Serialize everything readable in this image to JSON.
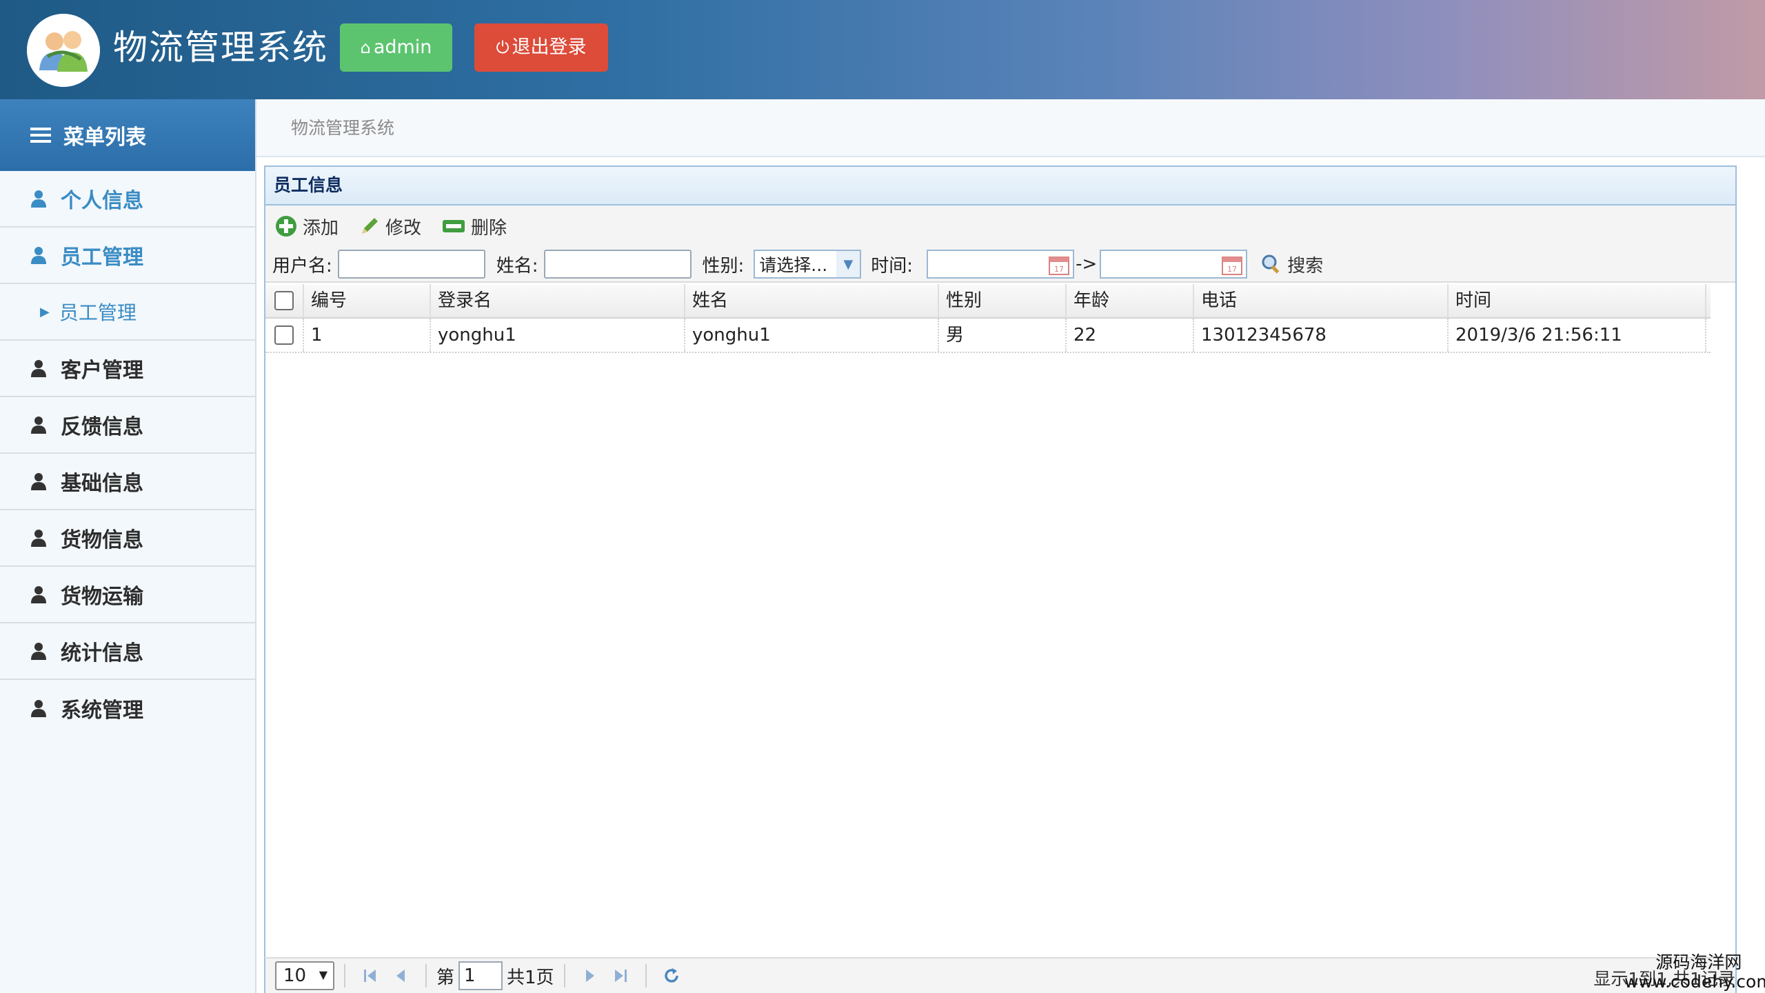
{
  "header": {
    "app_title": "物流管理系统",
    "admin_label": "admin",
    "logout_label": "退出登录"
  },
  "sidebar": {
    "menu_title": "菜单列表",
    "items": [
      {
        "label": "个人信息",
        "active": true
      },
      {
        "label": "员工管理",
        "active": true
      },
      {
        "label": "员工管理",
        "sub": true
      },
      {
        "label": "客户管理"
      },
      {
        "label": "反馈信息"
      },
      {
        "label": "基础信息"
      },
      {
        "label": "货物信息"
      },
      {
        "label": "货物运输"
      },
      {
        "label": "统计信息"
      },
      {
        "label": "系统管理"
      }
    ]
  },
  "breadcrumb": "物流管理系统",
  "panel": {
    "title": "员工信息",
    "toolbar": {
      "add": "添加",
      "edit": "修改",
      "delete": "删除"
    },
    "search": {
      "username_label": "用户名:",
      "name_label": "姓名:",
      "sex_label": "性别:",
      "sex_selected": "请选择...",
      "time_label": "时间:",
      "range_sep": "->",
      "search_label": "搜索"
    },
    "columns": [
      "编号",
      "登录名",
      "姓名",
      "性别",
      "年龄",
      "电话",
      "时间"
    ],
    "rows": [
      [
        "1",
        "yonghu1",
        "yonghu1",
        "男",
        "22",
        "13012345678",
        "2019/3/6 21:56:11"
      ]
    ]
  },
  "pager": {
    "page_size": "10",
    "page_prefix": "第",
    "page_value": "1",
    "total_pages": "共1页",
    "info": "显示1到1,共1记录"
  },
  "watermark": {
    "line1": "源码海洋网",
    "line2": "www.codehy.com"
  },
  "colors": {
    "admin_btn": "#5cc46f",
    "logout_btn": "#dd4b39",
    "sidebar_active": "#3a8cc4",
    "panel_border": "#9dc0dd"
  }
}
